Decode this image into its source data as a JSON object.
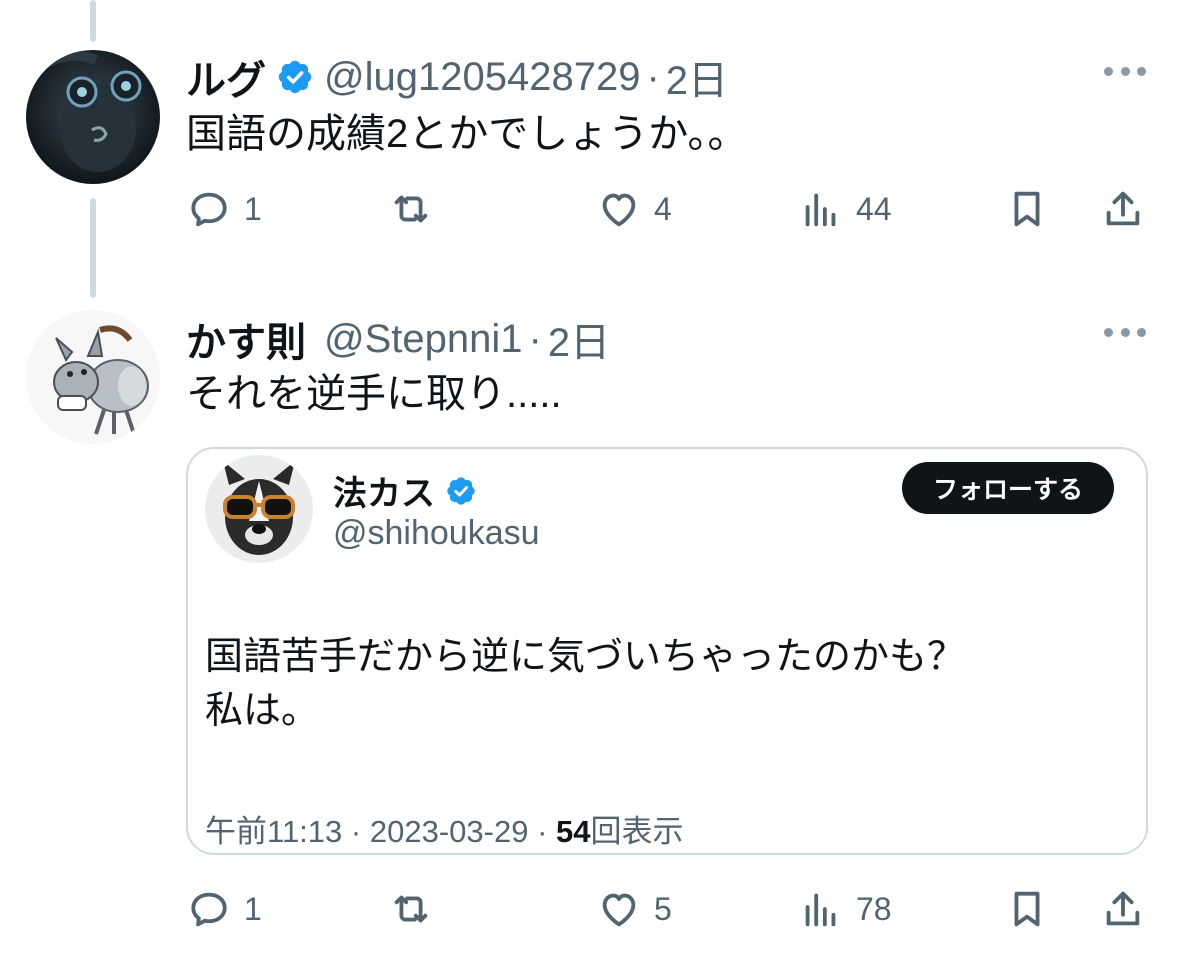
{
  "tweet1": {
    "display_name": "ルグ",
    "handle": "@lug1205428729",
    "separator": "·",
    "time": "2日",
    "text": "国語の成績2とかでしょうか。。",
    "replies": "1",
    "likes": "4",
    "views": "44"
  },
  "tweet2": {
    "display_name": "かす則",
    "handle": "@Stepnni1",
    "separator": "·",
    "time": "2日",
    "text": "それを逆手に取り.....",
    "replies": "1",
    "likes": "5",
    "views": "78"
  },
  "quoted": {
    "display_name": "法カス",
    "handle": "@shihoukasu",
    "follow_label": "フォローする",
    "line1": "国語苦手だから逆に気づいちゃったのかも？",
    "line2": "私は。",
    "time": "午前11:13",
    "sep1": "·",
    "date": "2023-03-29",
    "sep2": "·",
    "views_count": "54",
    "views_label": "回表示"
  },
  "colors": {
    "verified": "#1d9bf0",
    "secondary_text": "#536471",
    "primary_text": "#0f1419",
    "border": "#cfd9de"
  },
  "icons": [
    "reply-icon",
    "retweet-icon",
    "like-icon",
    "views-icon",
    "bookmark-icon",
    "share-icon",
    "verified-badge-icon",
    "more-icon"
  ]
}
